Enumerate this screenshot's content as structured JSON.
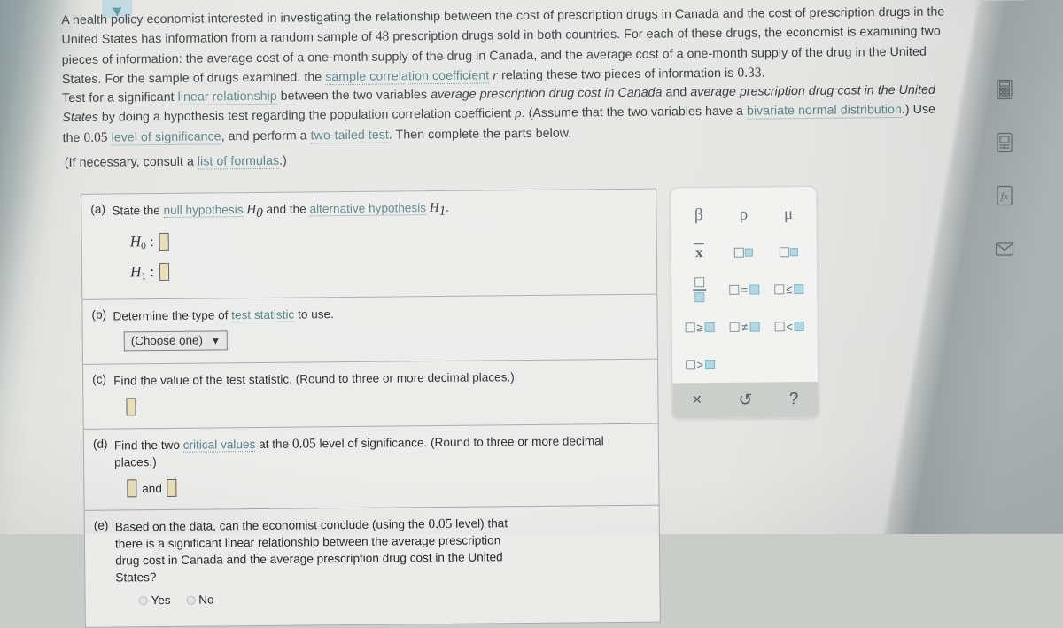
{
  "problem": {
    "paragraph1": {
      "pre": "A health policy economist interested in investigating the relationship between the cost of prescription drugs in Canada and the cost of prescription drugs in the United States has information from a random sample of ",
      "sample_size": "48",
      "mid": " prescription drugs sold in both countries. For each of these drugs, the economist is examining two pieces of information: the average cost of a one-month supply of the drug in Canada, and the average cost of a one-month supply of the drug in the United States. For the sample of drugs examined, the ",
      "link_sample_corr": "sample correlation coefficient",
      "r_symbol": "r",
      "post": " relating these two pieces of information is ",
      "r_value": "0.33",
      "end": "."
    },
    "paragraph2": {
      "pre": "Test for a significant ",
      "link_linear": "linear relationship",
      "mid1": " between the two variables ",
      "var1": "average prescription drug cost in Canada",
      "mid2": " and ",
      "var2": "average prescription drug cost in the United States",
      "mid3": " by doing a hypothesis test regarding the population correlation coefficient ",
      "rho": "ρ",
      "mid4": ". (Assume that the two variables have a ",
      "link_bivariate": "bivariate normal distribution",
      "mid5": ".) Use the ",
      "alpha": "0.05",
      "link_level": "level of significance",
      "mid6": ", and perform a ",
      "link_twotailed": "two-tailed test",
      "end": ". Then complete the parts below."
    },
    "paragraph3": {
      "pre": "(If necessary, consult a ",
      "link_formulas": "list of formulas",
      "end": ".)"
    }
  },
  "parts": {
    "a": {
      "label": "(a)",
      "pre": "State the ",
      "link_null": "null hypothesis",
      "h0_inline": "H",
      "h0_sub": "0",
      "mid": " and the ",
      "link_alt": "alternative hypothesis",
      "h1_inline": "H",
      "h1_sub": "1",
      "end": ".",
      "h0_label": "H",
      "h0_label_sub": "0",
      "h1_label": "H",
      "h1_label_sub": "1",
      "colon": ":"
    },
    "b": {
      "label": "(b)",
      "pre": "Determine the type of ",
      "link_test_stat": "test statistic",
      "end": " to use.",
      "select_value": "(Choose one)",
      "caret": "▼"
    },
    "c": {
      "label": "(c)",
      "text": "Find the value of the test statistic. (Round to three or more decimal places.)"
    },
    "d": {
      "label": "(d)",
      "pre": "Find the two ",
      "link_critical": "critical values",
      "mid": " at the ",
      "alpha": "0.05",
      "end": " level of significance. (Round to three or more decimal places.)",
      "and": "and"
    },
    "e": {
      "label": "(e)",
      "pre": "Based on the data, can the economist conclude (using the ",
      "alpha": "0.05",
      "end": " level) that there is a significant linear relationship between the average prescription drug cost in Canada and the average prescription drug cost in the United States?",
      "yes": "Yes",
      "no": "No"
    }
  },
  "palette": {
    "keys": [
      {
        "name": "beta-key",
        "kind": "greek",
        "glyph": "β"
      },
      {
        "name": "rho-key",
        "kind": "greek",
        "glyph": "ρ"
      },
      {
        "name": "mu-key",
        "kind": "greek",
        "glyph": "μ"
      },
      {
        "name": "xbar-key",
        "kind": "xbar",
        "glyph": "x"
      },
      {
        "name": "superscript-key",
        "kind": "sup",
        "glyph": ""
      },
      {
        "name": "subscript-key",
        "kind": "sub",
        "glyph": ""
      },
      {
        "name": "fraction-key",
        "kind": "frac",
        "glyph": ""
      },
      {
        "name": "equals-key",
        "kind": "rel",
        "glyph": "="
      },
      {
        "name": "less-than-or-equal-key",
        "kind": "rel",
        "glyph": "≤"
      },
      {
        "name": "greater-than-or-equal-key",
        "kind": "rel",
        "glyph": "≥"
      },
      {
        "name": "not-equal-key",
        "kind": "rel",
        "glyph": "≠"
      },
      {
        "name": "less-than-key",
        "kind": "rel",
        "glyph": "<"
      },
      {
        "name": "greater-than-key",
        "kind": "rel",
        "glyph": ">"
      }
    ],
    "footer": {
      "clear": "×",
      "undo": "↺",
      "help": "?"
    }
  },
  "rail": {
    "icons": [
      {
        "name": "calculator-icon"
      },
      {
        "name": "table-icon"
      },
      {
        "name": "formula-sheet-icon"
      },
      {
        "name": "message-icon"
      }
    ]
  },
  "colors": {
    "link": "#4f7f86",
    "answer_box_fill": "#e9ddb3",
    "palette_fill_square": "#aed6e0",
    "chevron_chip": "#bdd6de"
  }
}
